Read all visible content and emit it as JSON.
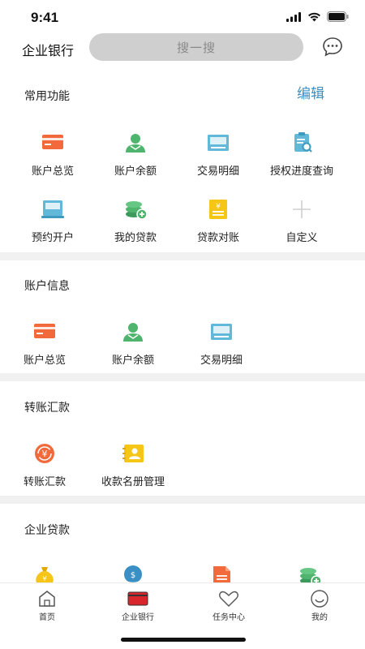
{
  "status": {
    "time": "9:41"
  },
  "header": {
    "title": "企业银行",
    "search_placeholder": "搜一搜"
  },
  "common": {
    "title": "常用功能",
    "edit_label": "编辑",
    "items": [
      {
        "label": "账户总览",
        "icon": "card-icon"
      },
      {
        "label": "账户余额",
        "icon": "user-icon"
      },
      {
        "label": "交易明细",
        "icon": "statement-icon"
      },
      {
        "label": "授权进度查询",
        "icon": "clipboard-search-icon"
      },
      {
        "label": "预约开户",
        "icon": "printer-icon"
      },
      {
        "label": "我的贷款",
        "icon": "coins-plus-icon"
      },
      {
        "label": "贷款对账",
        "icon": "yen-doc-icon"
      },
      {
        "label": "自定义",
        "icon": "plus-icon"
      }
    ]
  },
  "account_info": {
    "title": "账户信息",
    "items": [
      {
        "label": "账户总览",
        "icon": "card-icon"
      },
      {
        "label": "账户余额",
        "icon": "user-icon"
      },
      {
        "label": "交易明细",
        "icon": "statement-icon"
      }
    ]
  },
  "transfer": {
    "title": "转账汇款",
    "items": [
      {
        "label": "转账汇款",
        "icon": "yen-exchange-icon"
      },
      {
        "label": "收款名册管理",
        "icon": "contact-card-icon"
      }
    ]
  },
  "loans": {
    "title": "企业贷款",
    "items": [
      {
        "icon": "money-bag-icon"
      },
      {
        "icon": "hand-coin-icon"
      },
      {
        "icon": "document-icon"
      },
      {
        "icon": "coins-plus-icon"
      }
    ]
  },
  "tabbar": {
    "tabs": [
      {
        "label": "首页",
        "icon": "home-icon"
      },
      {
        "label": "企业银行",
        "icon": "bank-card-icon"
      },
      {
        "label": "任务中心",
        "icon": "heart-icon"
      },
      {
        "label": "我的",
        "icon": "smile-icon"
      }
    ]
  },
  "colors": {
    "accent": "#3a8fc4",
    "orange": "#f26a3c",
    "green": "#4fb56e",
    "teal": "#62b8d9",
    "yellow": "#f5c517",
    "tab_active": "#d9262c"
  }
}
